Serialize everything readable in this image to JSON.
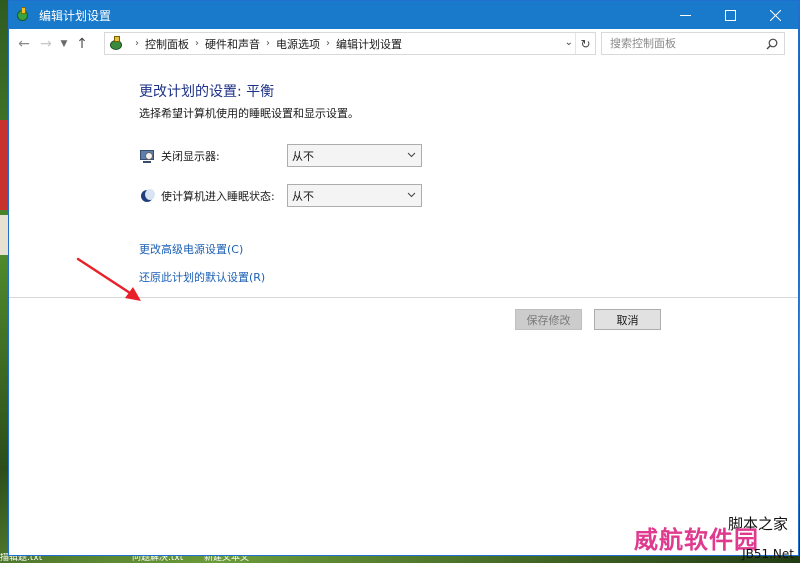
{
  "window": {
    "title": "编辑计划设置"
  },
  "address": {
    "breadcrumbs": [
      "控制面板",
      "硬件和声音",
      "电源选项",
      "编辑计划设置"
    ]
  },
  "search": {
    "placeholder": "搜索控制面板"
  },
  "main": {
    "heading": "更改计划的设置: 平衡",
    "subheading": "选择希望计算机使用的睡眠设置和显示设置。",
    "settings": [
      {
        "label": "关闭显示器:",
        "icon": "monitor-clock-icon",
        "value": "从不"
      },
      {
        "label": "使计算机进入睡眠状态:",
        "icon": "moon-icon",
        "value": "从不"
      }
    ],
    "links": {
      "advanced": "更改高级电源设置(C)",
      "restore": "还原此计划的默认设置(R)"
    },
    "buttons": {
      "save": "保存修改",
      "cancel": "取消"
    }
  },
  "desktop": {
    "bottom_texts": [
      "描辑题.txt",
      "问题解决.txt",
      "新建文本文"
    ]
  },
  "watermark": {
    "main": "威航软件园",
    "top": "脚本之家",
    "bottom": "JB51.Net"
  },
  "colors": {
    "titlebar": "#1979ca",
    "heading": "#1e3287",
    "link": "#1a5fb4",
    "arrow": "#e8202a"
  }
}
